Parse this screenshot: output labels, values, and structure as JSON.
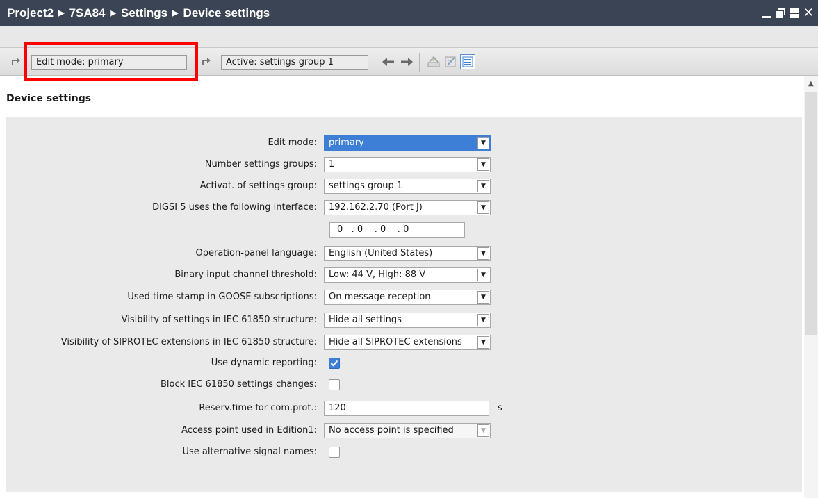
{
  "breadcrumb": [
    "Project2",
    "7SA84",
    "Settings",
    "Device settings"
  ],
  "toolbar": {
    "edit_mode_text": "Edit mode: primary",
    "active_text": "Active: settings group 1"
  },
  "section": {
    "title": "Device settings"
  },
  "colors": {
    "titlebar": "#3a4454",
    "selection": "#3d7fd6",
    "highlight": "#ff0000"
  },
  "form": {
    "edit_mode": {
      "label": "Edit mode:",
      "value": "primary"
    },
    "number_groups": {
      "label": "Number settings groups:",
      "value": "1"
    },
    "activation": {
      "label": "Activat. of settings group:",
      "value": "settings group 1"
    },
    "interface": {
      "label": "DIGSI 5 uses the following interface:",
      "value": "192.162.2.70 (Port J)"
    },
    "ip_address": {
      "value": "0   . 0    . 0    . 0"
    },
    "language": {
      "label": "Operation-panel language:",
      "value": "English (United States)"
    },
    "threshold": {
      "label": "Binary input channel threshold:",
      "value": "Low: 44 V, High: 88 V"
    },
    "goose_timestamp": {
      "label": "Used time stamp in GOOSE subscriptions:",
      "value": "On message reception"
    },
    "visibility_settings": {
      "label": "Visibility of settings in IEC 61850 structure:",
      "value": "Hide all settings"
    },
    "visibility_ext": {
      "label": "Visibility of SIPROTEC extensions in IEC 61850 structure:",
      "value": "Hide all SIPROTEC extensions"
    },
    "dynamic_reporting": {
      "label": "Use dynamic reporting:",
      "checked": true
    },
    "block_changes": {
      "label": "Block IEC 61850 settings changes:",
      "checked": false
    },
    "reserv_time": {
      "label": "Reserv.time for com.prot.:",
      "value": "120",
      "unit": "s"
    },
    "access_point": {
      "label": "Access point used in Edition1:",
      "value": "No access point is specified"
    },
    "alt_signal_names": {
      "label": "Use alternative signal names:",
      "checked": false
    }
  }
}
